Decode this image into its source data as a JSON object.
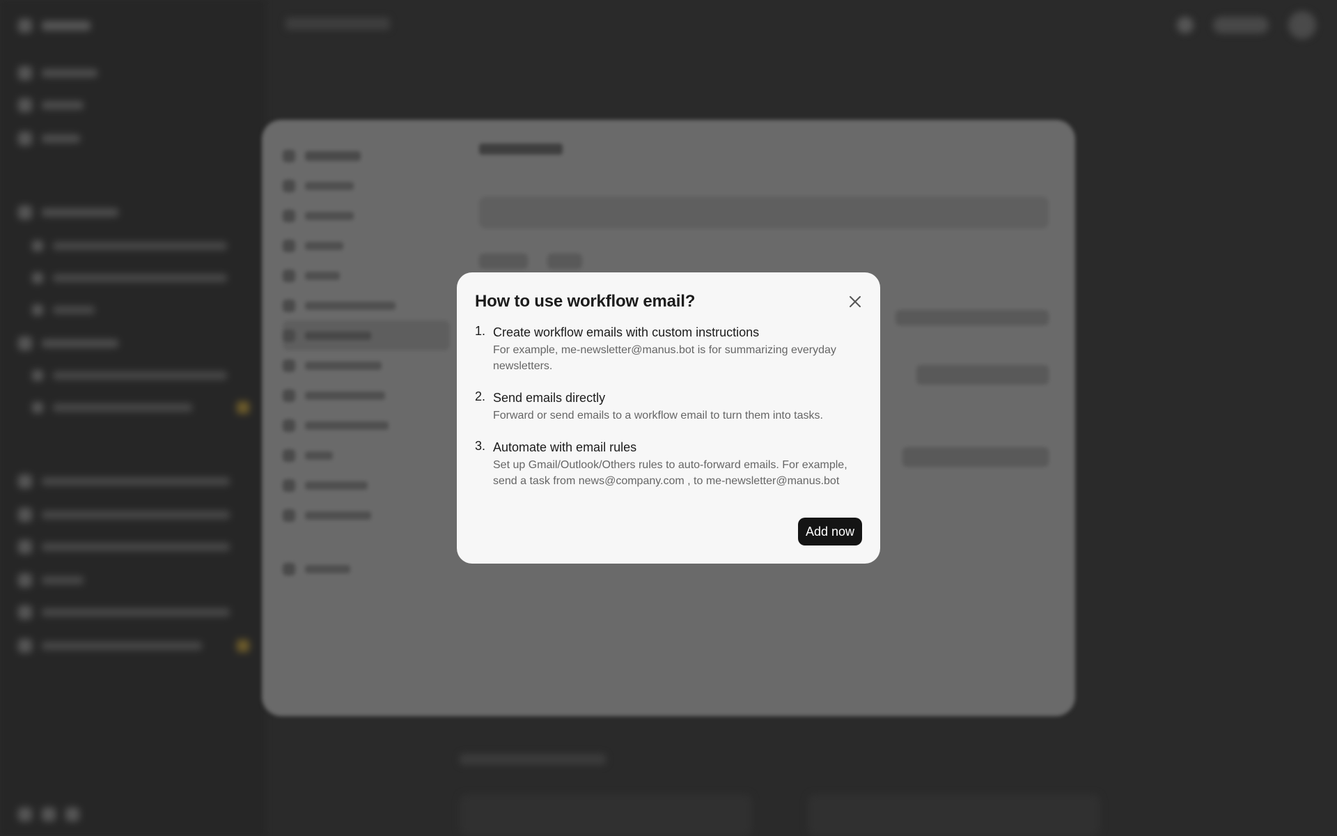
{
  "modal": {
    "title": "How to use workflow email?",
    "steps": [
      {
        "number": "1.",
        "title": "Create workflow emails with custom instructions",
        "desc": "For example, me-newsletter@manus.bot is for summarizing everyday newsletters."
      },
      {
        "number": "2.",
        "title": "Send emails directly",
        "desc": "Forward or send emails to a workflow email to turn them into tasks."
      },
      {
        "number": "3.",
        "title": "Automate with email rules",
        "desc": "Set up Gmail/Outlook/Others rules to auto-forward emails. For example, send a task from news@company.com , to me-newsletter@manus.bot"
      }
    ],
    "action_label": "Add now",
    "close_icon": "close-icon"
  },
  "colors": {
    "modal_bg": "#f7f7f7",
    "button_bg": "#141414",
    "backdrop": "#2a2a2a"
  }
}
